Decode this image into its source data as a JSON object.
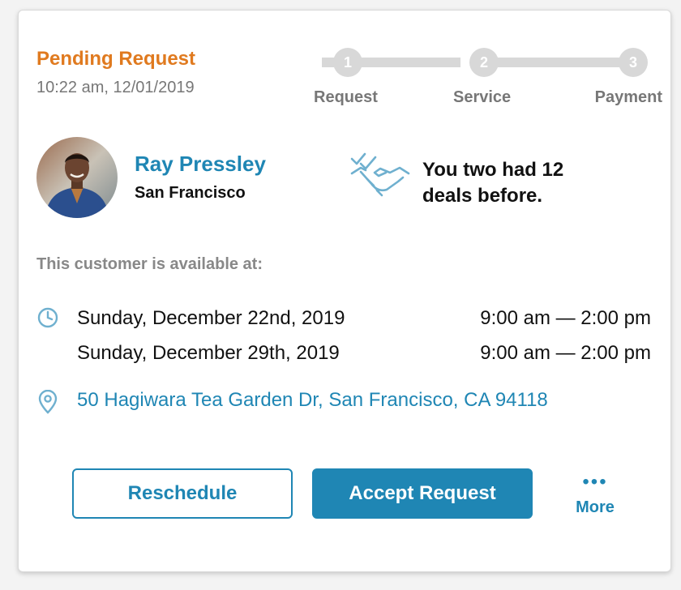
{
  "request": {
    "status": "Pending Request",
    "timestamp": "10:22 am, 12/01/2019"
  },
  "stepper": {
    "current_step": 0,
    "steps": [
      {
        "number": "1",
        "label": "Request"
      },
      {
        "number": "2",
        "label": "Service"
      },
      {
        "number": "3",
        "label": "Payment"
      }
    ]
  },
  "customer": {
    "name": "Ray Pressley",
    "city": "San Francisco"
  },
  "deals": {
    "text": "You two had 12 deals before."
  },
  "availability": {
    "label": "This customer is available at:",
    "slots": [
      {
        "date": "Sunday, December 22nd, 2019",
        "time": "9:00 am — 2:00 pm"
      },
      {
        "date": "Sunday, December 29th, 2019",
        "time": "9:00 am — 2:00 pm"
      }
    ],
    "icon": "clock-icon"
  },
  "location": {
    "address": "50 Hagiwara Tea Garden Dr, San Francisco, CA 94118",
    "icon": "location-pin-icon"
  },
  "actions": {
    "reschedule_label": "Reschedule",
    "accept_label": "Accept Request",
    "more_label": "More"
  },
  "colors": {
    "accent": "#1f86b4",
    "status": "#e07a1f",
    "muted": "#777777",
    "step_inactive": "#d8d8d8"
  }
}
